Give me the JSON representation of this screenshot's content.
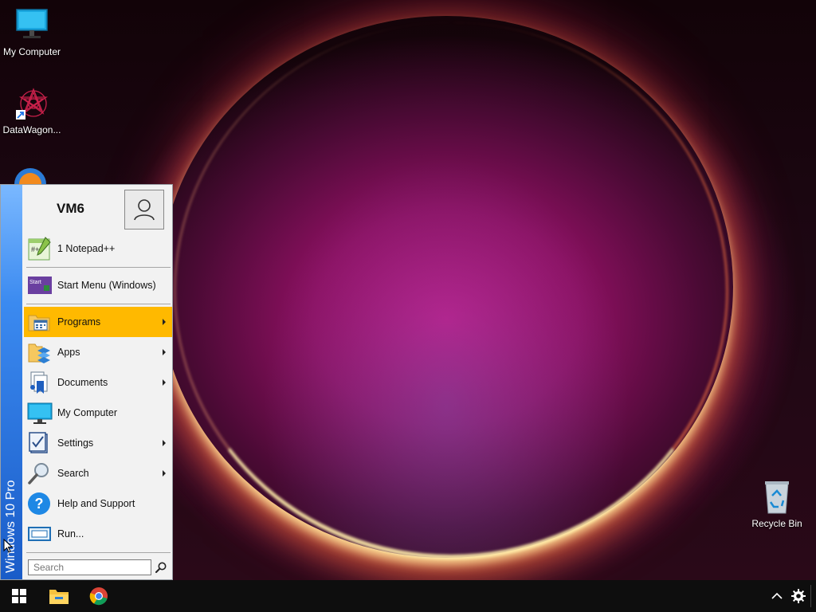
{
  "desktop": {
    "icons": [
      {
        "label": "My Computer",
        "icon": "monitor-icon"
      },
      {
        "label": "DataWagon...",
        "icon": "datawagon-icon"
      },
      {
        "label": "Recycle Bin",
        "icon": "recycle-bin-icon"
      }
    ]
  },
  "start_menu": {
    "banner_text": "Windows 10 Pro",
    "user_name": "VM6",
    "pinned": [
      {
        "label": "1 Notepad++",
        "icon": "notepad-plus-plus-icon"
      },
      {
        "label": "Start Menu (Windows)",
        "icon": "start-menu-icon"
      }
    ],
    "items": [
      {
        "label": "Programs",
        "icon": "programs-folder-icon",
        "submenu": true,
        "highlighted": true
      },
      {
        "label": "Apps",
        "icon": "apps-folder-icon",
        "submenu": true
      },
      {
        "label": "Documents",
        "icon": "documents-icon",
        "submenu": true
      },
      {
        "label": "My Computer",
        "icon": "monitor-icon",
        "submenu": false
      },
      {
        "label": "Settings",
        "icon": "settings-icon",
        "submenu": true
      },
      {
        "label": "Search",
        "icon": "magnifier-icon",
        "submenu": true
      },
      {
        "label": "Help and Support",
        "icon": "help-icon",
        "submenu": false
      },
      {
        "label": "Run...",
        "icon": "run-icon",
        "submenu": false
      }
    ],
    "search": {
      "placeholder": "Search",
      "value": ""
    },
    "highlight_color": "#ffb900",
    "banner_color": "#1a5cc8"
  },
  "taskbar": {
    "items": [
      {
        "name": "start-button",
        "icon": "windows-logo-icon"
      },
      {
        "name": "file-explorer",
        "icon": "folder-icon"
      },
      {
        "name": "chrome",
        "icon": "chrome-icon"
      }
    ],
    "tray": [
      {
        "name": "show-hidden-icons",
        "icon": "chevron-up-icon"
      },
      {
        "name": "settings",
        "icon": "gear-icon"
      }
    ]
  }
}
